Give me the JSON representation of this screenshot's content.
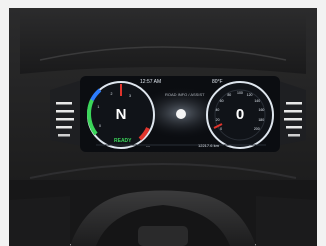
{
  "status_bar": {
    "time": "12:57 AM",
    "temperature": "80°F",
    "message": "ROAD INFO / ASSIST"
  },
  "left_gauge": {
    "gear": "N",
    "ready_label": "READY",
    "scale_labels": [
      "0",
      "1",
      "2",
      "3"
    ]
  },
  "right_gauge": {
    "speed": "0",
    "scale_labels": [
      "0",
      "20",
      "40",
      "60",
      "80",
      "100",
      "120",
      "140",
      "160",
      "180",
      "200"
    ]
  },
  "bottom_bar": {
    "left_info": "---",
    "odometer": "12217.6 km"
  },
  "colors": {
    "screen": "#0b0d11",
    "gauge_ring": "#dfe6ee",
    "eco_green": "#3bd65a",
    "charge_blue": "#2c7dff",
    "redline": "#e0342c"
  }
}
